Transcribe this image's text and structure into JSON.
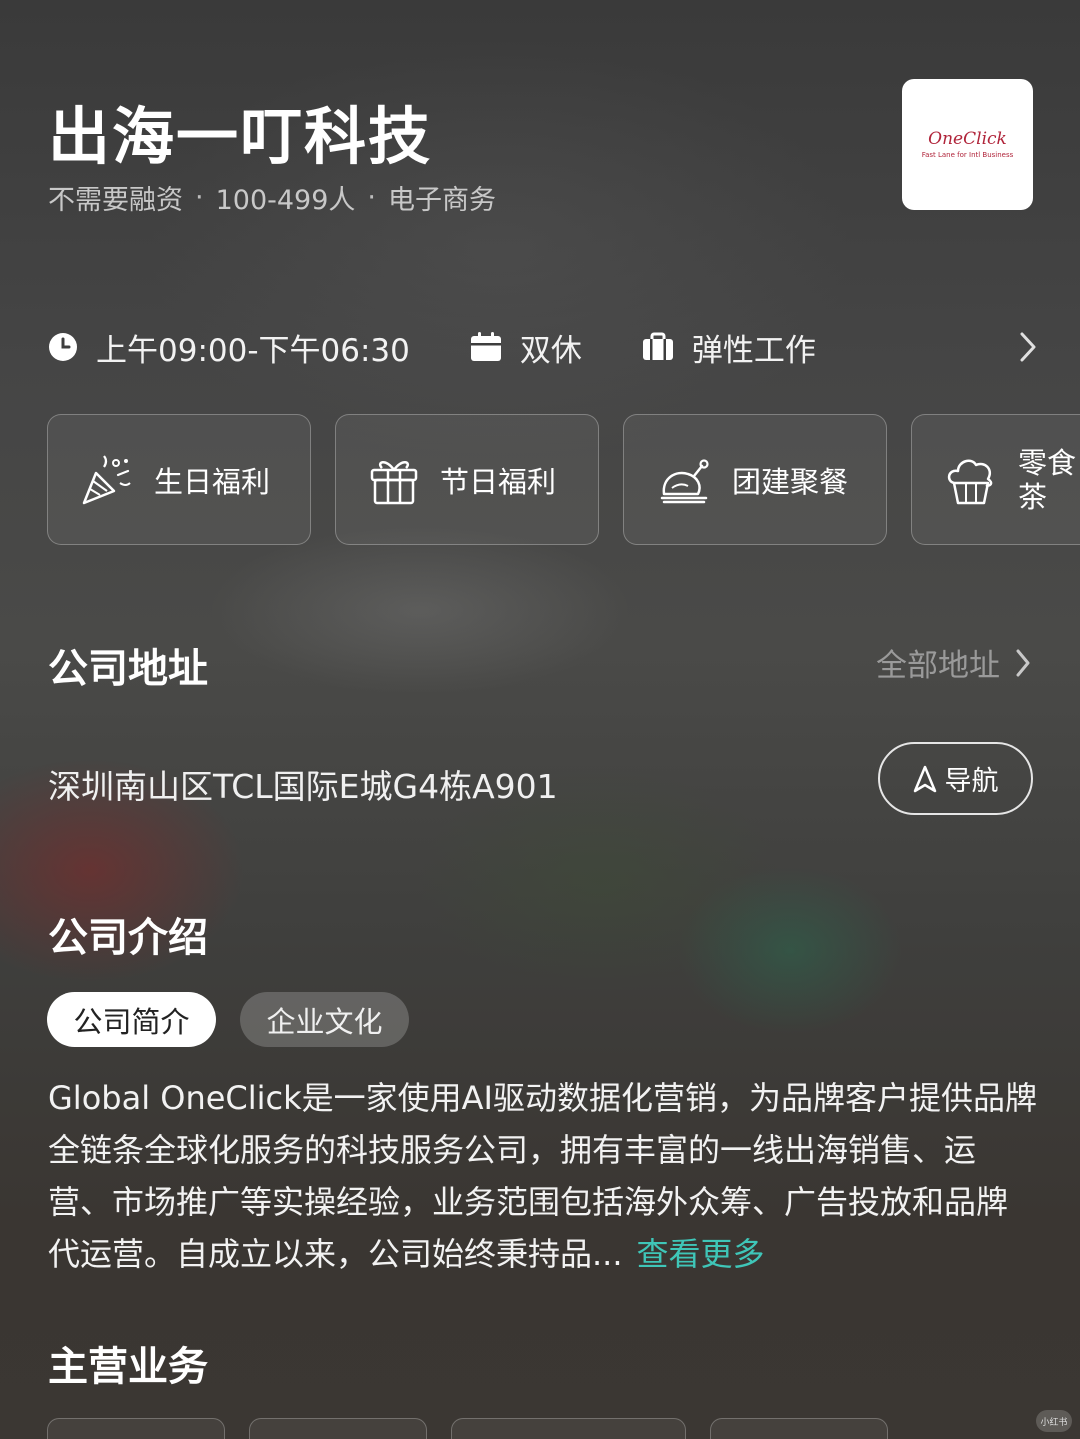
{
  "company": {
    "name": "出海一叮科技",
    "funding": "不需要融资",
    "size": "100-499人",
    "industry": "电子商务",
    "separator": "·",
    "logo": {
      "main": "OneClick",
      "sub": "Fast Lane for Intl Business",
      "color": "#b0243a"
    }
  },
  "work_info": {
    "hours": "上午09:00-下午06:30",
    "rest": "双休",
    "mode": "弹性工作",
    "icons": [
      "clock-icon",
      "calendar-icon",
      "briefcase-icon",
      "chevron-right-icon"
    ]
  },
  "benefits": [
    {
      "label": "生日福利",
      "icon": "party-popper-icon"
    },
    {
      "label": "节日福利",
      "icon": "gift-icon"
    },
    {
      "label": "团建聚餐",
      "icon": "roast-chicken-icon"
    },
    {
      "label_line1": "零食",
      "label_line2": "茶",
      "icon": "cupcake-icon"
    }
  ],
  "address_section": {
    "title": "公司地址",
    "all_link": "全部地址",
    "address": "深圳南山区TCL国际E城G4栋A901",
    "nav_button": "导航"
  },
  "intro_section": {
    "title": "公司介绍",
    "tabs": [
      {
        "label": "公司简介",
        "active": true
      },
      {
        "label": "企业文化",
        "active": false
      }
    ],
    "text": "Global OneClick是一家使用AI驱动数据化营销，为品牌客户提供品牌全链条全球化服务的科技服务公司，拥有丰富的一线出海销售、运营、市场推广等实操经验，业务范围包括海外众筹、广告投放和品牌代运营。自成立以来，公司始终秉持品...",
    "more_link": "查看更多",
    "accent_color": "#3fc6b8"
  },
  "business_section": {
    "title": "主营业务"
  },
  "watermark": "小红书"
}
